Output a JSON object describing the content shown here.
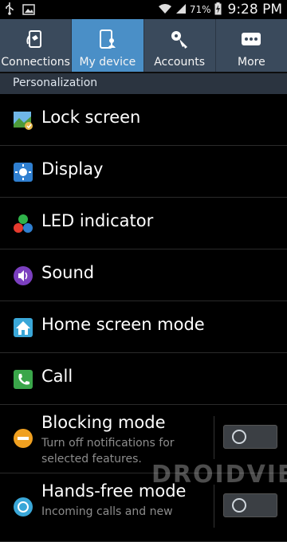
{
  "status_bar": {
    "battery": "71%",
    "time": "9:28 PM"
  },
  "tabs": [
    {
      "label": "Connections",
      "icon": "connections-icon",
      "active": false
    },
    {
      "label": "My device",
      "icon": "my-device-icon",
      "active": true
    },
    {
      "label": "Accounts",
      "icon": "accounts-key-icon",
      "active": false
    },
    {
      "label": "More",
      "icon": "more-dots-icon",
      "active": false
    }
  ],
  "section_header": "Personalization",
  "items": [
    {
      "label": "Lock screen",
      "icon": "lock-screen-icon"
    },
    {
      "label": "Display",
      "icon": "display-icon"
    },
    {
      "label": "LED indicator",
      "icon": "led-indicator-icon"
    },
    {
      "label": "Sound",
      "icon": "sound-icon"
    },
    {
      "label": "Home screen mode",
      "icon": "home-screen-icon"
    },
    {
      "label": "Call",
      "icon": "call-icon"
    },
    {
      "label": "Blocking mode",
      "sub": "Turn off notifications for selected features.",
      "icon": "blocking-mode-icon",
      "toggle": "off"
    },
    {
      "label": "Hands-free mode",
      "sub": "Incoming calls and new",
      "icon": "hands-free-icon",
      "toggle": "off"
    }
  ],
  "watermark": "DROIDVIEWS",
  "colors": {
    "tab_bar": "#3a4a5c",
    "tab_active": "#4a8fc7",
    "section": "#2b3440",
    "background": "#000000"
  }
}
